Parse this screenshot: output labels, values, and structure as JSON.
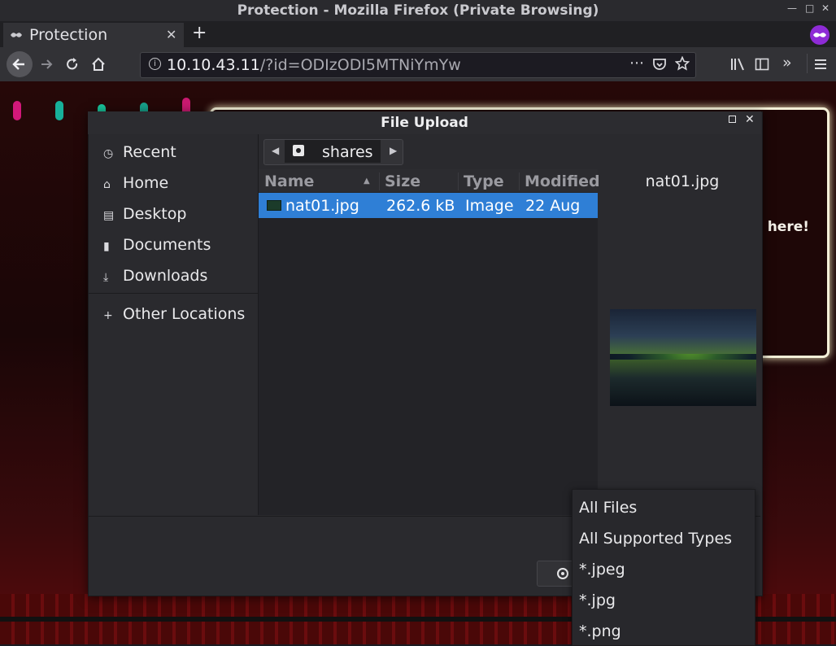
{
  "window": {
    "title": "Protection - Mozilla Firefox (Private Browsing)",
    "controls": [
      "minimize",
      "maximize",
      "close"
    ]
  },
  "tabs": [
    {
      "label": "Protection",
      "icon": "incognito-mask-icon"
    }
  ],
  "navbar": {
    "url_host": "10.10.43.11",
    "url_path": "/?id=ODIzODI5MTNiYmYw",
    "icons": [
      "back-icon",
      "forward-icon",
      "reload-icon",
      "home-icon",
      "info-icon",
      "more-icon",
      "pocket-icon",
      "bookmark-star-icon",
      "library-icon",
      "sidebar-icon",
      "overflow-icon",
      "menu-icon"
    ]
  },
  "webpage": {
    "visible_text": "t here!"
  },
  "dialog": {
    "title": "File Upload",
    "sidebar": [
      {
        "label": "Recent",
        "icon": "clock-icon"
      },
      {
        "label": "Home",
        "icon": "home-icon"
      },
      {
        "label": "Desktop",
        "icon": "desktop-icon"
      },
      {
        "label": "Documents",
        "icon": "document-icon"
      },
      {
        "label": "Downloads",
        "icon": "download-icon"
      }
    ],
    "other_locations": {
      "label": "Other Locations",
      "icon": "plus-icon"
    },
    "path": {
      "folder": "shares"
    },
    "columns": [
      "Name",
      "Size",
      "Type",
      "Modified"
    ],
    "files": [
      {
        "name": "nat01.jpg",
        "size": "262.6 kB",
        "type": "Image",
        "modified": "22 Aug",
        "selected": true
      }
    ],
    "preview": {
      "filename": "nat01.jpg"
    }
  },
  "filter_dropdown": {
    "options": [
      "All Files",
      "All Supported Types",
      "*.jpeg",
      "*.jpg",
      "*.png"
    ]
  },
  "colors": {
    "selection": "#2f7fd6",
    "dialog_bg": "#2a2a2e",
    "private_badge": "#8e2bd6"
  }
}
